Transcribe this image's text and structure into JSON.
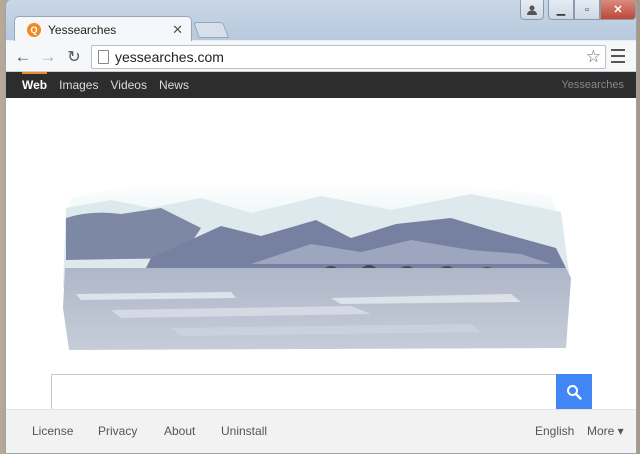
{
  "browser": {
    "tab_title": "Yessearches",
    "favicon_letter": "Q",
    "url": "yessearches.com"
  },
  "nav": {
    "items": [
      "Web",
      "Images",
      "Videos",
      "News"
    ],
    "active": "Web",
    "brand": "Yessearches"
  },
  "search": {
    "placeholder": ""
  },
  "footer": {
    "links": [
      "License",
      "Privacy",
      "About",
      "Uninstall"
    ],
    "language": "English",
    "more": "More ▾"
  },
  "colors": {
    "accent": "#f08a24",
    "search_button": "#4285f4",
    "topnav_bg": "#2d2d2d"
  }
}
